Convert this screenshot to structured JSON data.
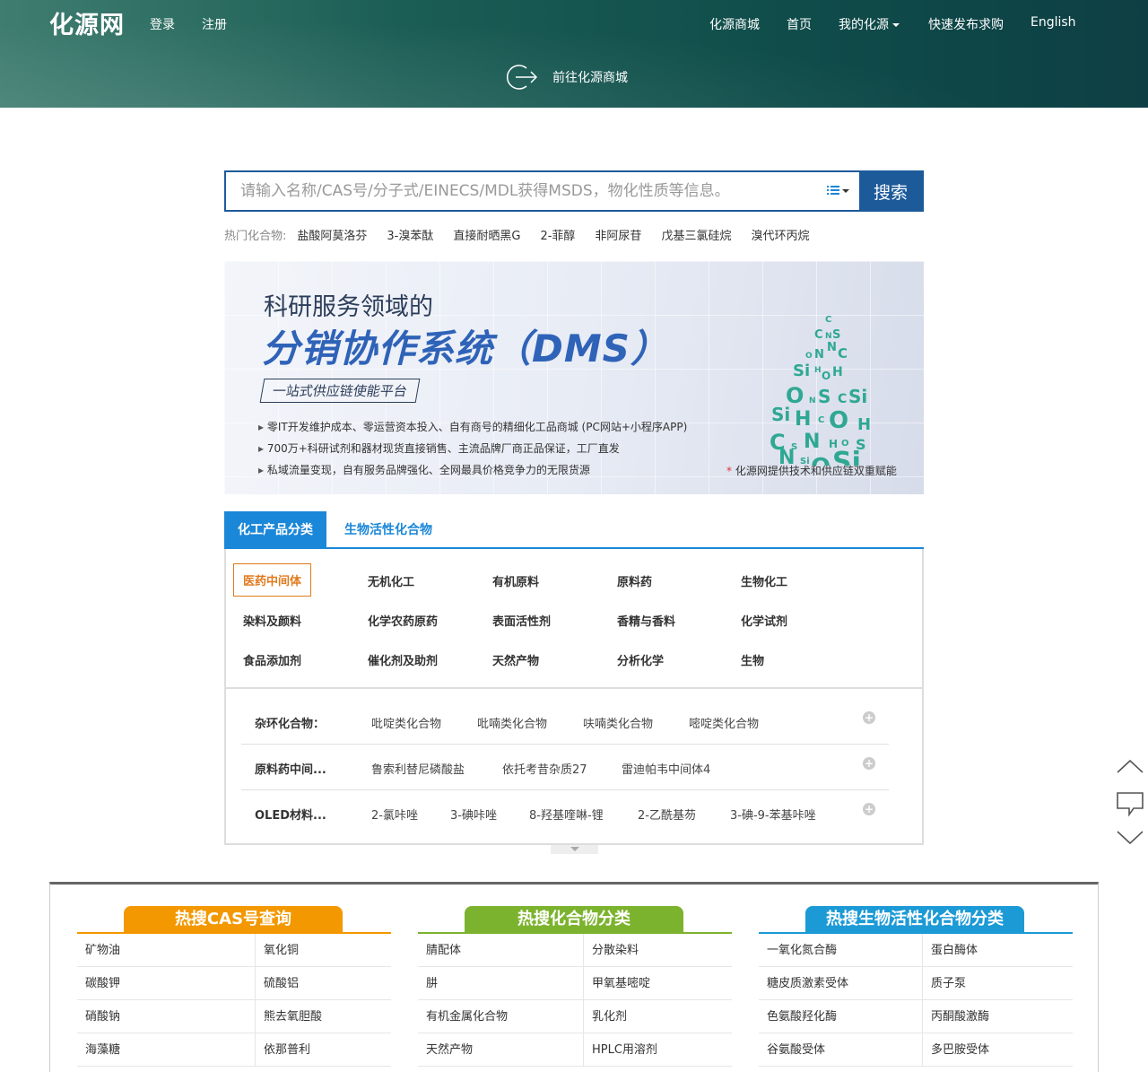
{
  "header": {
    "logo": "化源网",
    "login": "登录",
    "register": "注册",
    "nav": [
      "化源商城",
      "首页",
      "我的化源",
      "快速发布求购",
      "English"
    ],
    "goto_mall": "前往化源商城"
  },
  "search": {
    "placeholder": "请输入名称/CAS号/分子式/EINECS/MDL获得MSDS，物化性质等信息。",
    "button": "搜索",
    "hot_label": "热门化合物:",
    "hot_items": [
      "盐酸阿莫洛芬",
      "3-溴苯酞",
      "直接耐晒黑G",
      "2-菲醇",
      "非阿尿苷",
      "戊基三氯硅烷",
      "溴代环丙烷"
    ]
  },
  "banner": {
    "subtitle": "科研服务领域的",
    "title": "分销协作系统（DMS）",
    "tag": "一站式供应链使能平台",
    "bullets": [
      "零IT开发维护成本、零运营资本投入、自有商号的精细化工品商城 (PC网站+小程序APP)",
      "700万+科研试剂和器材现货直接销售、主流品牌厂商正品保证，工厂直发",
      "私域流量变现，自有服务品牌强化、全网最具价格竞争力的无限货源"
    ],
    "note_star": "*",
    "note": "化源网提供技术和供应链双重赋能"
  },
  "tabs": [
    "化工产品分类",
    "生物活性化合物"
  ],
  "categories": [
    "医药中间体",
    "无机化工",
    "有机原料",
    "原料药",
    "生物化工",
    "染料及颜料",
    "化学农药原药",
    "表面活性剂",
    "香精与香料",
    "化学试剂",
    "食品添加剂",
    "催化剂及助剂",
    "天然产物",
    "分析化学",
    "生物"
  ],
  "rows": [
    {
      "label": "杂环化合物：",
      "items": [
        "吡啶类化合物",
        "吡喃类化合物",
        "呋喃类化合物",
        "嘧啶类化合物"
      ]
    },
    {
      "label": "原料药中间...",
      "items": [
        "鲁索利替尼磷酸盐",
        "依托考昔杂质27",
        "雷迪帕韦中间体4"
      ]
    },
    {
      "label": "OLED材料...",
      "items": [
        "2-氯咔唑",
        "3-碘咔唑",
        "8-羟基喹啉-锂",
        "2-乙酰基芴",
        "3-碘-9-苯基咔唑"
      ]
    }
  ],
  "panels": [
    {
      "title": "热搜CAS号查询",
      "color": "#f39800",
      "cells": [
        "矿物油",
        "氧化铜",
        "碳酸钾",
        "硫酸铝",
        "硝酸钠",
        "熊去氧胆酸",
        "海藻糖",
        "依那普利"
      ]
    },
    {
      "title": "热搜化合物分类",
      "color": "#7cb32e",
      "cells": [
        "腈配体",
        "分散染料",
        "肼",
        "甲氧基嘧啶",
        "有机金属化合物",
        "乳化剂",
        "天然产物",
        "HPLC用溶剂"
      ]
    },
    {
      "title": "热搜生物活性化合物分类",
      "color": "#1c9ad6",
      "cells": [
        "一氧化氮合酶",
        "蛋白酶体",
        "糖皮质激素受体",
        "质子泵",
        "色氨酸羟化酶",
        "丙酮酸激酶",
        "谷氨酸受体",
        "多巴胺受体"
      ]
    }
  ]
}
